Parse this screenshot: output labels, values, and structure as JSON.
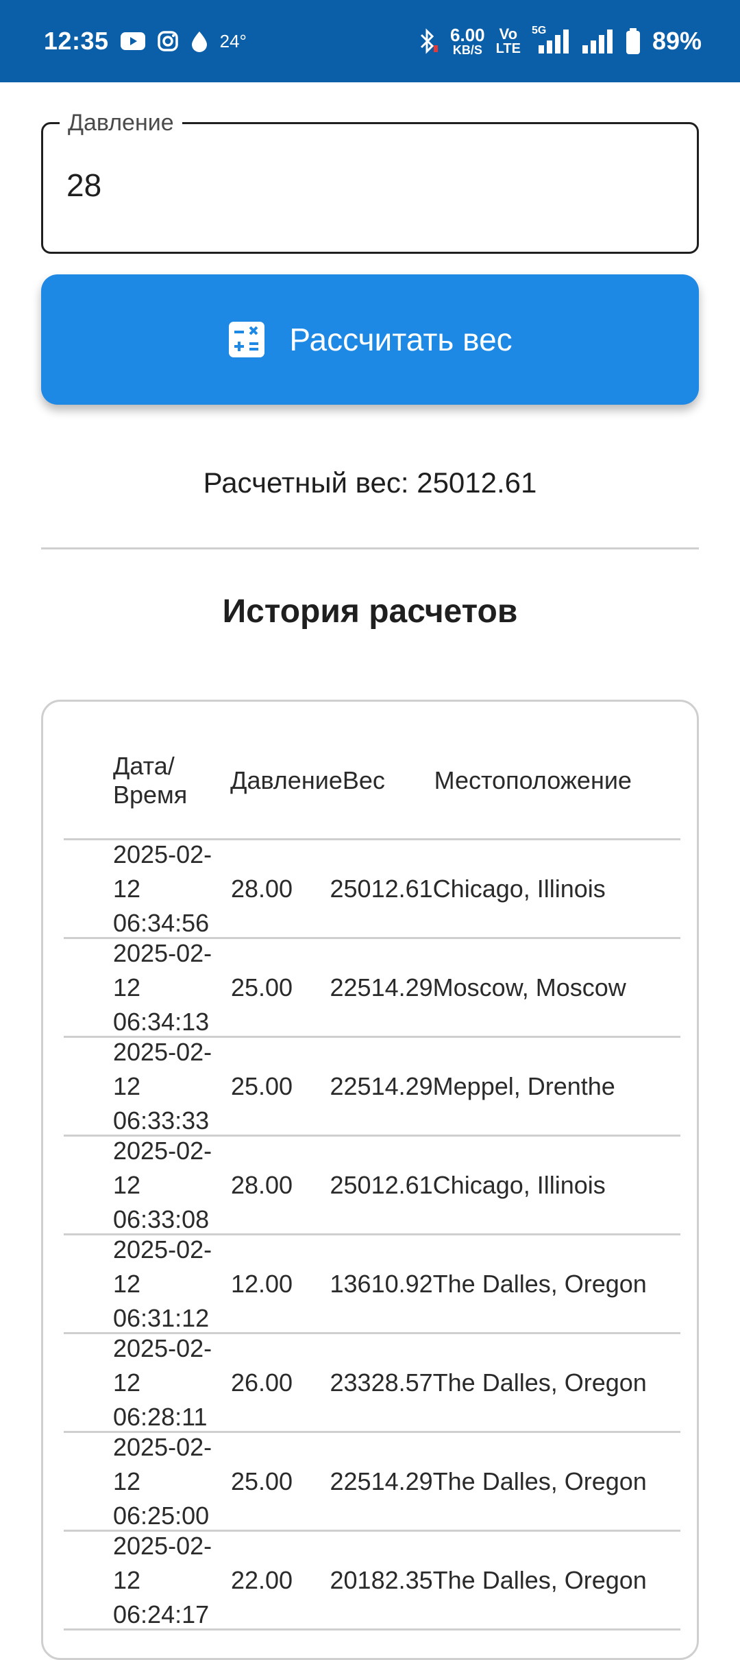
{
  "status_bar": {
    "time": "12:35",
    "temperature": "24°",
    "net_speed_value": "6.00",
    "net_speed_unit": "KB/S",
    "volte_top": "Vo",
    "volte_bottom": "LTE",
    "network_5g": "5G",
    "battery": "89%"
  },
  "pressure_input": {
    "label": "Давление",
    "value": "28"
  },
  "calculate_button": {
    "label": "Рассчитать вес"
  },
  "result": {
    "text": "Расчетный вес: 25012.61"
  },
  "history": {
    "title": "История расчетов",
    "columns": [
      "Дата/Время",
      "Давление",
      "Вес",
      "Местоположение"
    ],
    "rows": [
      {
        "date": "2025-02-12",
        "time": "06:34:56",
        "pressure": "28.00",
        "weight": "25012.61",
        "location": "Chicago, Illinois"
      },
      {
        "date": "2025-02-12",
        "time": "06:34:13",
        "pressure": "25.00",
        "weight": "22514.29",
        "location": "Moscow, Moscow"
      },
      {
        "date": "2025-02-12",
        "time": "06:33:33",
        "pressure": "25.00",
        "weight": "22514.29",
        "location": "Meppel, Drenthe"
      },
      {
        "date": "2025-02-12",
        "time": "06:33:08",
        "pressure": "28.00",
        "weight": "25012.61",
        "location": "Chicago, Illinois"
      },
      {
        "date": "2025-02-12",
        "time": "06:31:12",
        "pressure": "12.00",
        "weight": "13610.92",
        "location": "The Dalles, Oregon"
      },
      {
        "date": "2025-02-12",
        "time": "06:28:11",
        "pressure": "26.00",
        "weight": "23328.57",
        "location": "The Dalles, Oregon"
      },
      {
        "date": "2025-02-12",
        "time": "06:25:00",
        "pressure": "25.00",
        "weight": "22514.29",
        "location": "The Dalles, Oregon"
      },
      {
        "date": "2025-02-12",
        "time": "06:24:17",
        "pressure": "22.00",
        "weight": "20182.35",
        "location": "The Dalles, Oregon"
      }
    ]
  },
  "colors": {
    "status_bar": "#0b5ea8",
    "button": "#1e88e5",
    "divider": "#cfcfcf"
  }
}
